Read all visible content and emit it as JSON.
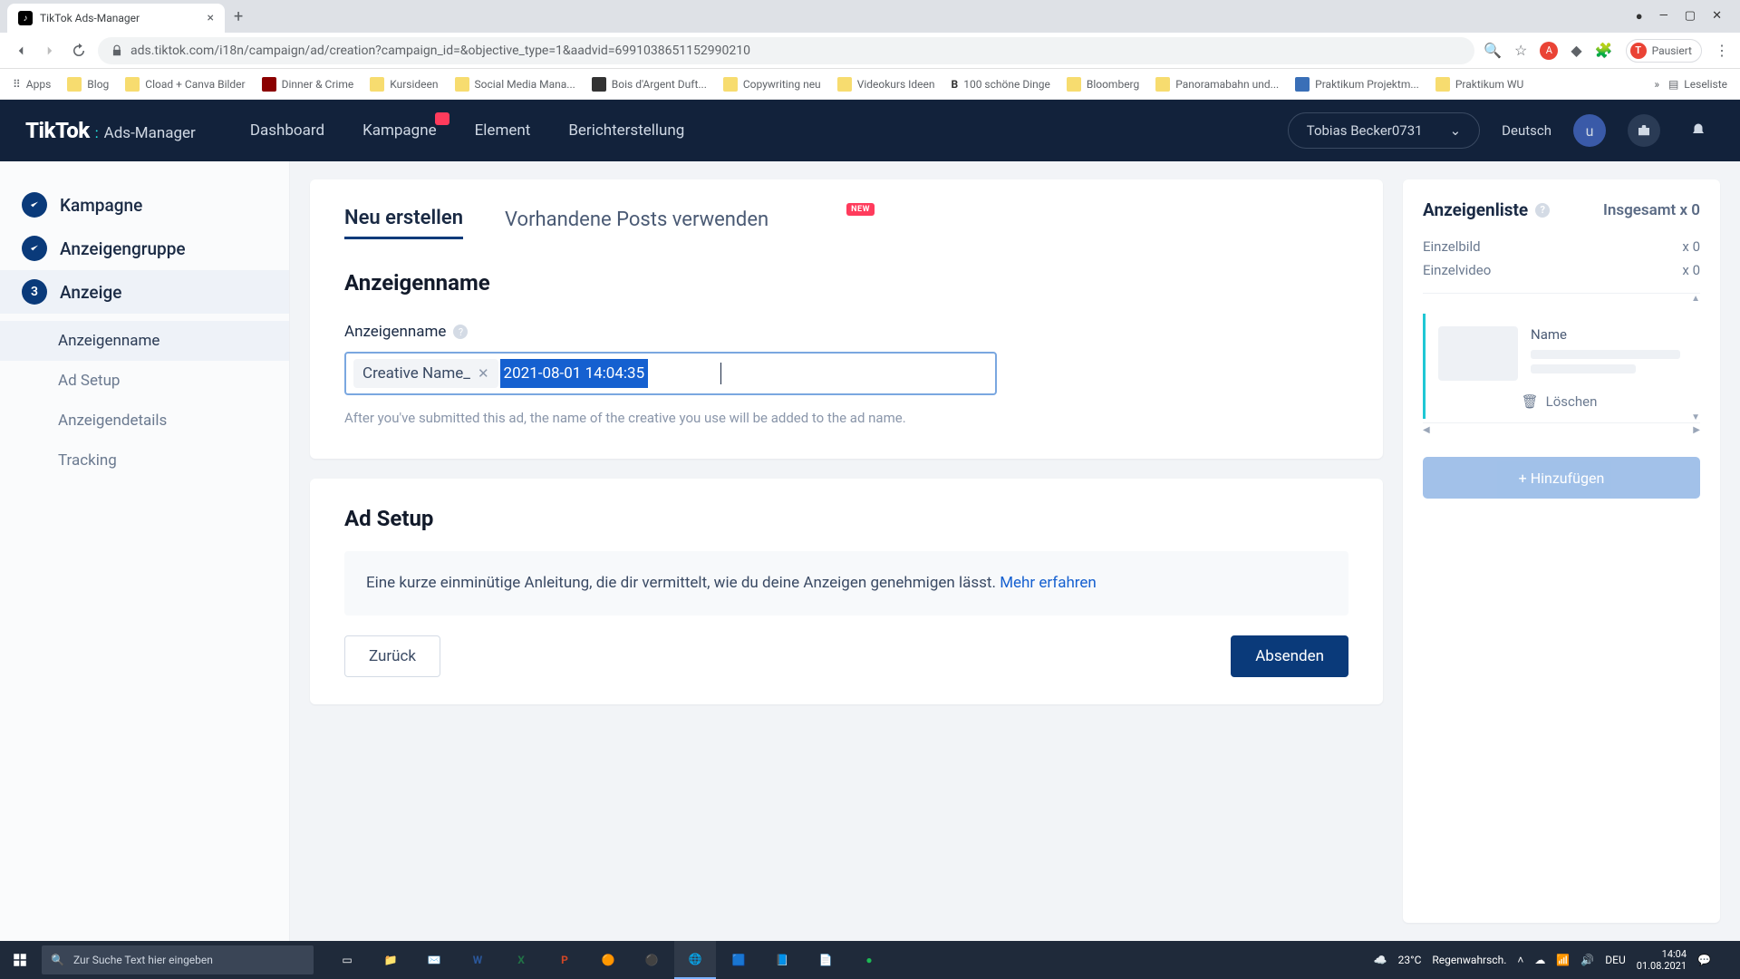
{
  "browser": {
    "tab_title": "TikTok Ads-Manager",
    "url": "ads.tiktok.com/i18n/campaign/ad/creation?campaign_id=&objective_type=1&aadvid=6991038651152990210",
    "pause_label": "Pausiert",
    "readlist_label": "Leseliste",
    "bookmarks": [
      "Apps",
      "Blog",
      "Cload + Canva Bilder",
      "Dinner & Crime",
      "Kursideen",
      "Social Media Mana...",
      "Bois d'Argent Duft...",
      "Copywriting neu",
      "Videokurs Ideen",
      "100 schöne Dinge",
      "Bloomberg",
      "Panoramabahn und...",
      "Praktikum Projektm...",
      "Praktikum WU"
    ]
  },
  "header": {
    "brand": "TikTok",
    "product": "Ads-Manager",
    "nav": [
      "Dashboard",
      "Kampagne",
      "Element",
      "Berichterstellung"
    ],
    "account": "Tobias Becker0731",
    "language": "Deutsch",
    "avatar_letter": "u"
  },
  "stepper": {
    "steps": [
      {
        "label": "Kampagne",
        "state": "done"
      },
      {
        "label": "Anzeigengruppe",
        "state": "done"
      },
      {
        "label": "Anzeige",
        "state": "active",
        "number": "3"
      }
    ],
    "substeps": [
      "Anzeigenname",
      "Ad Setup",
      "Anzeigendetails",
      "Tracking"
    ]
  },
  "main": {
    "tabs": {
      "create": "Neu erstellen",
      "existing": "Vorhandene Posts verwenden",
      "new_badge": "NEW"
    },
    "section_title": "Anzeigenname",
    "field_label": "Anzeigenname",
    "chip_text": "Creative Name_",
    "selected_text": "2021-08-01 14:04:35",
    "hint": "After you've submitted this ad, the name of the creative you use will be added to the ad name.",
    "ad_setup_title": "Ad Setup",
    "ad_setup_text": "Eine kurze einminütige Anleitung, die dir vermittelt, wie du deine Anzeigen genehmigen lässt. ",
    "ad_setup_link": "Mehr erfahren",
    "back_btn": "Zurück",
    "submit_btn": "Absenden"
  },
  "right": {
    "title": "Anzeigenliste",
    "total_label": "Insgesamt x 0",
    "rows": [
      {
        "label": "Einzelbild",
        "count": "x 0"
      },
      {
        "label": "Einzelvideo",
        "count": "x 0"
      }
    ],
    "name_label": "Name",
    "delete_label": "Löschen",
    "add_label": "+ Hinzufügen"
  },
  "taskbar": {
    "search_placeholder": "Zur Suche Text hier eingeben",
    "temp": "23°C",
    "weather": "Regenwahrsch.",
    "lang": "DEU",
    "time": "14:04",
    "date": "01.08.2021"
  }
}
